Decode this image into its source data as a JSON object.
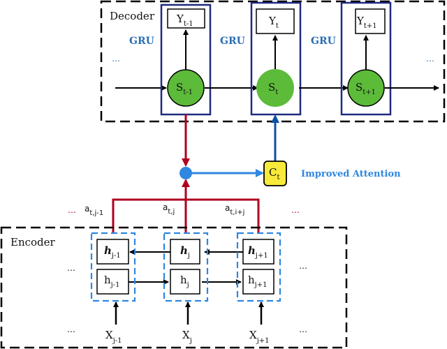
{
  "decoder": {
    "title": "Decoder",
    "gru_labels": [
      "GRU",
      "GRU",
      "GRU"
    ],
    "ellipsis": "…",
    "cells": [
      {
        "output_main": "Y",
        "output_sub": "t-1",
        "state_main": "S",
        "state_sub": "t-1"
      },
      {
        "output_main": "Y",
        "output_sub": "t",
        "state_main": "S",
        "state_sub": "t"
      },
      {
        "output_main": "Y",
        "output_sub": "t+1",
        "state_main": "S",
        "state_sub": "t+1"
      }
    ]
  },
  "attention": {
    "context_main": "C",
    "context_sub": "t",
    "label": "Improved Attention",
    "weights": [
      {
        "main": "a",
        "sub": "t,j-1"
      },
      {
        "main": "a",
        "sub": "t,j"
      },
      {
        "main": "a",
        "sub": "t,i+j"
      }
    ],
    "ellipsis": "…"
  },
  "encoder": {
    "title": "Encoder",
    "ellipsis": "…",
    "cells": [
      {
        "backward_main": "h",
        "backward_sub": "j-1",
        "forward_main": "h",
        "forward_sub": "j-1",
        "input_main": "X",
        "input_sub": "j-1"
      },
      {
        "backward_main": "h",
        "backward_sub": "j",
        "forward_main": "h",
        "forward_sub": "j",
        "input_main": "X",
        "input_sub": "j"
      },
      {
        "backward_main": "h",
        "backward_sub": "j+1",
        "forward_main": "h",
        "forward_sub": "j+1",
        "input_main": "X",
        "input_sub": "j+1"
      }
    ]
  },
  "colors": {
    "gru_box": "#1f2a80",
    "state_fill": "#5dbb3a",
    "attention_red": "#b00020",
    "attention_blue": "#2f87e0",
    "context_blue": "#0d4fa0",
    "context_fill": "#f7ea3a",
    "encoder_group": "#2f87e0"
  }
}
